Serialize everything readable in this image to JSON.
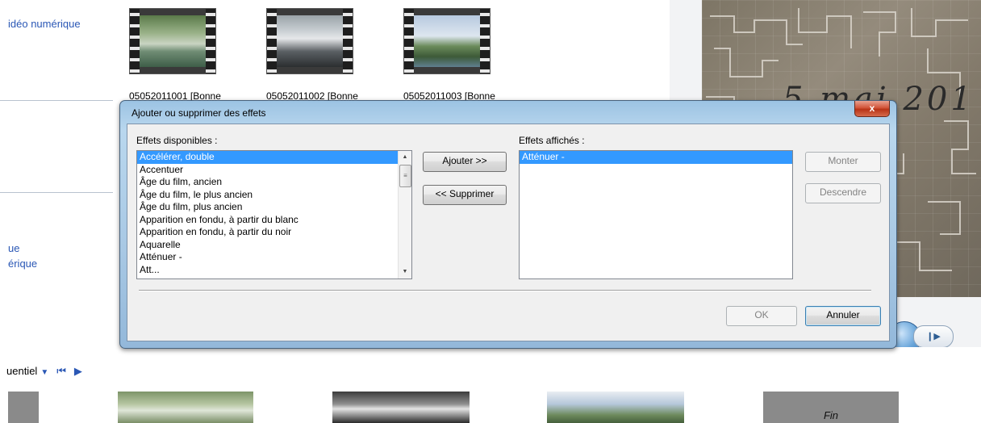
{
  "left_pane": {
    "links": [
      "idéo numérique",
      "ue",
      "érique"
    ]
  },
  "clips": [
    {
      "name": "05052011001 [Bonne"
    },
    {
      "name": "05052011002 [Bonne"
    },
    {
      "name": "05052011003 [Bonne"
    }
  ],
  "preview": {
    "overlay_text": "5 mai 201"
  },
  "storyboard": {
    "mode_label": "uentiel",
    "end_title": "Fin"
  },
  "dialog": {
    "title": "Ajouter ou supprimer des effets",
    "close_symbol": "x",
    "available_label": "Effets disponibles :",
    "displayed_label": "Effets affichés :",
    "available_effects": [
      "Accélérer, double",
      "Accentuer",
      "Âge du film, ancien",
      "Âge du film, le plus ancien",
      "Âge du film, plus ancien",
      "Apparition en fondu, à partir du blanc",
      "Apparition en fondu, à partir du noir",
      "Aquarelle",
      "Atténuer -",
      "Att..."
    ],
    "selected_available_index": 0,
    "displayed_effects": [
      "Atténuer -"
    ],
    "selected_displayed_index": 0,
    "add_button": "Ajouter >>",
    "remove_button": "<< Supprimer",
    "up_button": "Monter",
    "down_button": "Descendre",
    "ok_button": "OK",
    "cancel_button": "Annuler"
  },
  "colors": {
    "selection": "#3399ff",
    "link": "#2a57b5",
    "frame": "#a8c8e4",
    "close_button": "#c8452a"
  }
}
